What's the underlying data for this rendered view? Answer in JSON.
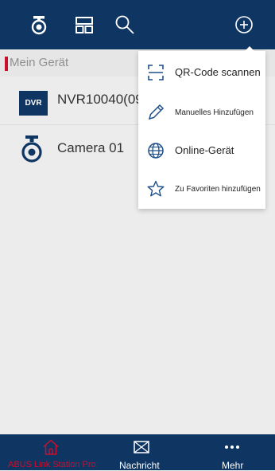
{
  "toolbar": {
    "icons": [
      "camera-icon",
      "layout-icon",
      "search-icon",
      "add-icon"
    ]
  },
  "section": {
    "label": "Mein Gerät"
  },
  "devices": [
    {
      "badge": "DVR",
      "name": "NVR10040(09"
    },
    {
      "name": "Camera 01",
      "icon": "camera-icon"
    }
  ],
  "add_menu": {
    "items": [
      {
        "icon": "qr-scan-icon",
        "label": "QR-Code scannen"
      },
      {
        "icon": "pencil-icon",
        "label": "Manuelles Hinzufügen"
      },
      {
        "icon": "globe-icon",
        "label": "Online-Gerät"
      },
      {
        "icon": "star-icon",
        "label": "Zu Favoriten hinzufügen"
      }
    ]
  },
  "bottom_nav": {
    "items": [
      {
        "icon": "home-icon",
        "label": "ABUS Link Station Pro",
        "active": true
      },
      {
        "icon": "message-icon",
        "label": "Nachricht",
        "active": false
      },
      {
        "icon": "more-icon",
        "label": "Mehr",
        "active": false
      }
    ]
  },
  "colors": {
    "brand": "#0f3663",
    "accent": "#c8102e",
    "background": "#ececec"
  }
}
